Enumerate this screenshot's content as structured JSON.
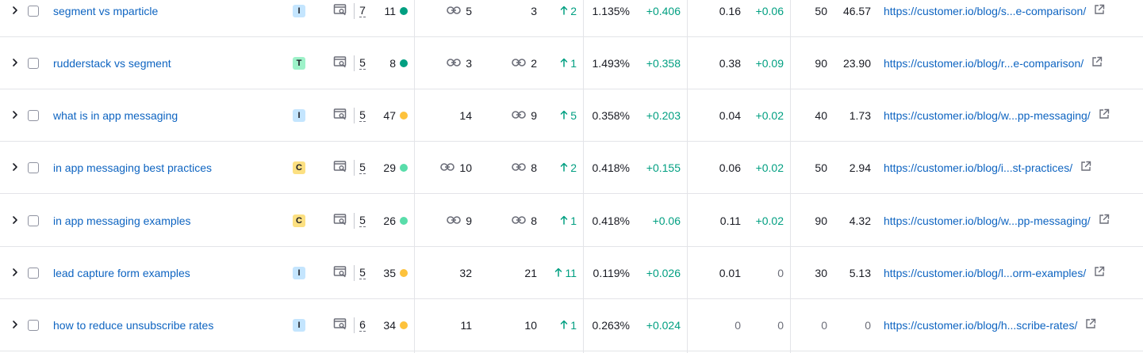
{
  "colors": {
    "link": "#0e64c1",
    "positive": "#009f81",
    "intent": {
      "I": "#c4e5fe",
      "T": "#9ef2c9",
      "C": "#fce081"
    },
    "kd": {
      "dark_green": "#009f81",
      "light_green": "#59ddaa",
      "orange": "#fdc23c"
    }
  },
  "rows": [
    {
      "keyword": "segment vs mparticle",
      "intent": "I",
      "position": "7",
      "kd": "11",
      "kd_color": "dark_green",
      "serp_link_1": "5",
      "serp_link_1_icon": true,
      "serp_link_2": "3",
      "serp_link_2_icon": false,
      "change": "2",
      "change_dir": "up",
      "traffic": "1.135%",
      "traffic_change": "+0.406",
      "cpc": "0.16",
      "cpc_change": "+0.06",
      "competition": "50",
      "volume": "46.57",
      "url": "https://customer.io/blog/s...e-comparison/"
    },
    {
      "keyword": "rudderstack vs segment",
      "intent": "T",
      "position": "5",
      "kd": "8",
      "kd_color": "dark_green",
      "serp_link_1": "3",
      "serp_link_1_icon": true,
      "serp_link_2": "2",
      "serp_link_2_icon": true,
      "change": "1",
      "change_dir": "up",
      "traffic": "1.493%",
      "traffic_change": "+0.358",
      "cpc": "0.38",
      "cpc_change": "+0.09",
      "competition": "90",
      "volume": "23.90",
      "url": "https://customer.io/blog/r...e-comparison/"
    },
    {
      "keyword": "what is in app messaging",
      "intent": "I",
      "position": "5",
      "kd": "47",
      "kd_color": "orange",
      "serp_link_1": "14",
      "serp_link_1_icon": false,
      "serp_link_2": "9",
      "serp_link_2_icon": true,
      "change": "5",
      "change_dir": "up",
      "traffic": "0.358%",
      "traffic_change": "+0.203",
      "cpc": "0.04",
      "cpc_change": "+0.02",
      "competition": "40",
      "volume": "1.73",
      "url": "https://customer.io/blog/w...pp-messaging/"
    },
    {
      "keyword": "in app messaging best practices",
      "intent": "C",
      "position": "5",
      "kd": "29",
      "kd_color": "light_green",
      "serp_link_1": "10",
      "serp_link_1_icon": true,
      "serp_link_2": "8",
      "serp_link_2_icon": true,
      "change": "2",
      "change_dir": "up",
      "traffic": "0.418%",
      "traffic_change": "+0.155",
      "cpc": "0.06",
      "cpc_change": "+0.02",
      "competition": "50",
      "volume": "2.94",
      "url": "https://customer.io/blog/i...st-practices/"
    },
    {
      "keyword": "in app messaging examples",
      "intent": "C",
      "position": "5",
      "kd": "26",
      "kd_color": "light_green",
      "serp_link_1": "9",
      "serp_link_1_icon": true,
      "serp_link_2": "8",
      "serp_link_2_icon": true,
      "change": "1",
      "change_dir": "up",
      "traffic": "0.418%",
      "traffic_change": "+0.06",
      "cpc": "0.11",
      "cpc_change": "+0.02",
      "competition": "90",
      "volume": "4.32",
      "url": "https://customer.io/blog/w...pp-messaging/"
    },
    {
      "keyword": "lead capture form examples",
      "intent": "I",
      "position": "5",
      "kd": "35",
      "kd_color": "orange",
      "serp_link_1": "32",
      "serp_link_1_icon": false,
      "serp_link_2": "21",
      "serp_link_2_icon": false,
      "change": "11",
      "change_dir": "up",
      "traffic": "0.119%",
      "traffic_change": "+0.026",
      "cpc": "0.01",
      "cpc_change": "0",
      "competition": "30",
      "volume": "5.13",
      "url": "https://customer.io/blog/l...orm-examples/"
    },
    {
      "keyword": "how to reduce unsubscribe rates",
      "intent": "I",
      "position": "6",
      "kd": "34",
      "kd_color": "orange",
      "serp_link_1": "11",
      "serp_link_1_icon": false,
      "serp_link_2": "10",
      "serp_link_2_icon": false,
      "change": "1",
      "change_dir": "up",
      "traffic": "0.263%",
      "traffic_change": "+0.024",
      "cpc": "0",
      "cpc_change": "0",
      "competition": "0",
      "volume": "0",
      "url": "https://customer.io/blog/h...scribe-rates/"
    }
  ]
}
